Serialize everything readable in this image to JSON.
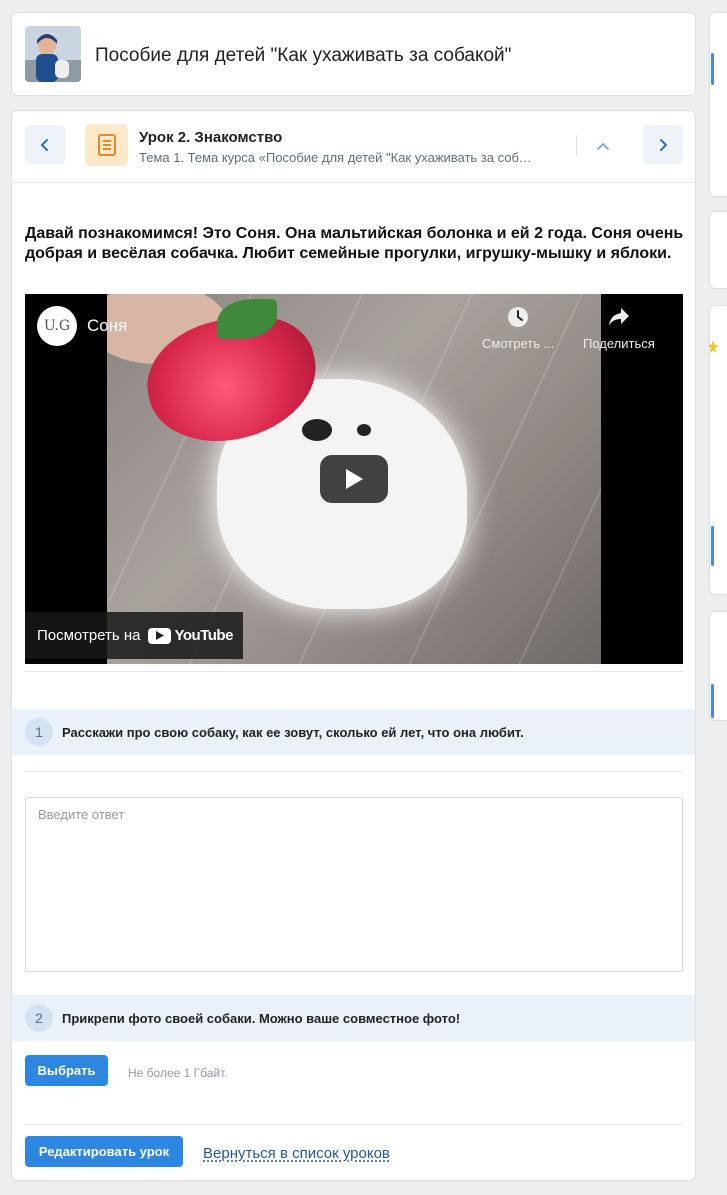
{
  "course": {
    "title": "Пособие для детей \"Как ухаживать за собакой\""
  },
  "lesson": {
    "title": "Урок 2. Знакомство",
    "subtitle": "Тема 1. Тема курса «Пособие для детей \"Как ухаживать за собакой\"»",
    "intro_text": "Давай познакомимся! Это Соня. Она мальтийская болонка и ей 2 года. Соня очень добрая и весёлая собачка. Любит семейные прогулки, игрушку-мышку и яблоки."
  },
  "video": {
    "channel_logo_text": "U.G",
    "title": "Соня",
    "watch_later_label": "Смотреть ...",
    "share_label": "Поделиться",
    "watch_on_label": "Посмотреть на",
    "youtube_label": "YouTube"
  },
  "questions": [
    {
      "number": "1",
      "text": "Расскажи про свою собаку, как ее зовут, сколько ей лет, что она любит."
    },
    {
      "number": "2",
      "text": "Прикрепи фото своей собаки. Можно ваше совместное фото!"
    }
  ],
  "answer": {
    "placeholder": "Введите ответ",
    "value": ""
  },
  "upload": {
    "choose_label": "Выбрать",
    "size_hint": "Не более 1 Гбайт."
  },
  "footer": {
    "edit_label": "Редактировать урок",
    "back_label": "Вернуться в список уроков"
  },
  "colors": {
    "accent": "#2d86e0",
    "link": "#2a5885",
    "question_bg": "#ebf1f9",
    "lesson_icon_bg": "#fbe9c9",
    "lesson_icon": "#e8892b"
  },
  "icons": {
    "prev": "chevron-left-icon",
    "next": "chevron-right-icon",
    "collapse": "chevron-up-icon",
    "lesson": "document-icon",
    "play": "play-icon",
    "watch_later": "clock-icon",
    "share": "share-arrow-icon"
  }
}
